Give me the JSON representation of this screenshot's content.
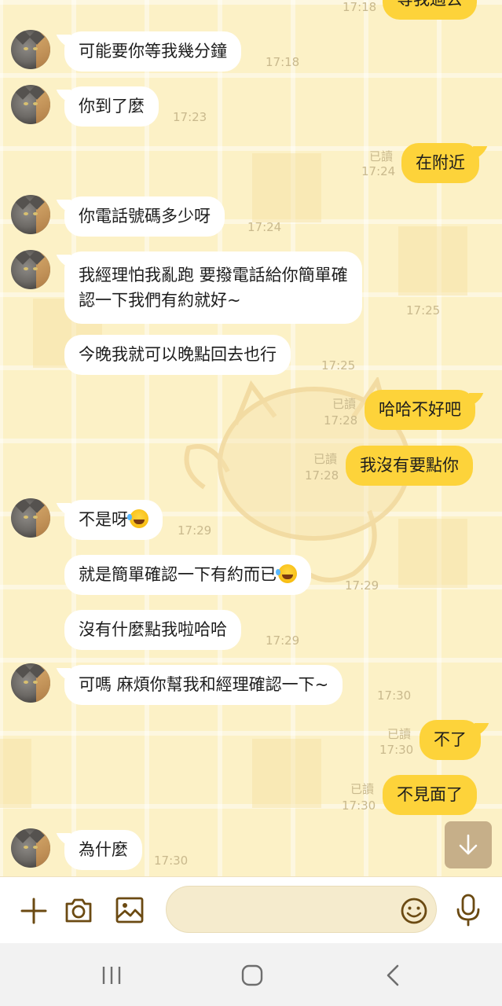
{
  "messages": [
    {
      "side": "me",
      "text": "等我過去",
      "time": "17:18",
      "read": ""
    },
    {
      "side": "them",
      "text": "可能要你等我幾分鐘",
      "time": "17:18",
      "avatar": true
    },
    {
      "side": "them",
      "text": "你到了麼",
      "time": "17:23",
      "avatar": true
    },
    {
      "side": "me",
      "text": "在附近",
      "time": "17:24",
      "read": "已讀"
    },
    {
      "side": "them",
      "text": "你電話號碼多少呀",
      "time": "17:24",
      "avatar": true
    },
    {
      "side": "them",
      "line1": "我經理怕我亂跑  要撥電話給你簡單確",
      "line2": "認一下我們有約就好~",
      "time": "17:25",
      "avatar": true
    },
    {
      "side": "them",
      "text": "今晚我就可以晚點回去也行",
      "time": "17:25",
      "avatar": false
    },
    {
      "side": "me",
      "text": "哈哈不好吧",
      "time": "17:28",
      "read": "已讀"
    },
    {
      "side": "me",
      "text": "我沒有要點你",
      "time": "17:28",
      "read": "已讀"
    },
    {
      "side": "them",
      "text": "不是呀",
      "time": "17:29",
      "avatar": true,
      "emoji": "rofl-emoji"
    },
    {
      "side": "them",
      "text": "就是簡單確認一下有約而已",
      "time": "17:29",
      "avatar": false,
      "emoji": "rofl-emoji"
    },
    {
      "side": "them",
      "text": "沒有什麼點我啦哈哈",
      "time": "17:29",
      "avatar": false
    },
    {
      "side": "them",
      "text": "可嗎 麻煩你幫我和經理確認一下~",
      "time": "17:30",
      "avatar": true
    },
    {
      "side": "me",
      "text": "不了",
      "time": "17:30",
      "read": "已讀"
    },
    {
      "side": "me",
      "text": "不見面了",
      "time": "17:30",
      "read": "已讀"
    },
    {
      "side": "them",
      "text": "為什麼",
      "time": "17:30",
      "avatar": true
    }
  ],
  "input": {
    "placeholder": ""
  },
  "icons": {
    "add": "plus-icon",
    "camera": "camera-icon",
    "gallery": "image-icon",
    "emoji": "smiley-icon",
    "mic": "microphone-icon",
    "scroll": "arrow-down-icon",
    "nav_recent": "recent-apps-icon",
    "nav_home": "home-icon",
    "nav_back": "back-icon"
  },
  "colors": {
    "my_bubble": "#fdd33a",
    "their_bubble": "#ffffff",
    "background": "#fcf1c6",
    "timestamp": "#c9b98d",
    "icon": "#6b4a12"
  }
}
